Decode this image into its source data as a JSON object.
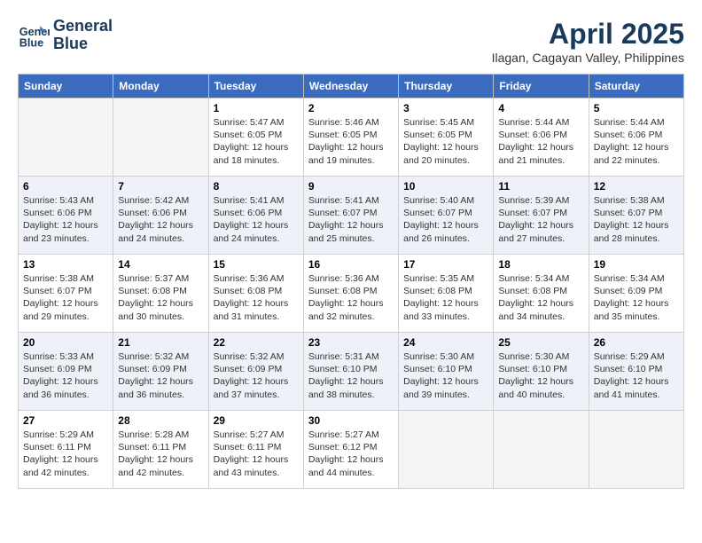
{
  "header": {
    "logo_line1": "General",
    "logo_line2": "Blue",
    "title": "April 2025",
    "subtitle": "Ilagan, Cagayan Valley, Philippines"
  },
  "calendar": {
    "weekdays": [
      "Sunday",
      "Monday",
      "Tuesday",
      "Wednesday",
      "Thursday",
      "Friday",
      "Saturday"
    ],
    "weeks": [
      {
        "stripe": false,
        "days": [
          {
            "num": "",
            "info": ""
          },
          {
            "num": "",
            "info": ""
          },
          {
            "num": "1",
            "info": "Sunrise: 5:47 AM\nSunset: 6:05 PM\nDaylight: 12 hours and 18 minutes."
          },
          {
            "num": "2",
            "info": "Sunrise: 5:46 AM\nSunset: 6:05 PM\nDaylight: 12 hours and 19 minutes."
          },
          {
            "num": "3",
            "info": "Sunrise: 5:45 AM\nSunset: 6:05 PM\nDaylight: 12 hours and 20 minutes."
          },
          {
            "num": "4",
            "info": "Sunrise: 5:44 AM\nSunset: 6:06 PM\nDaylight: 12 hours and 21 minutes."
          },
          {
            "num": "5",
            "info": "Sunrise: 5:44 AM\nSunset: 6:06 PM\nDaylight: 12 hours and 22 minutes."
          }
        ]
      },
      {
        "stripe": true,
        "days": [
          {
            "num": "6",
            "info": "Sunrise: 5:43 AM\nSunset: 6:06 PM\nDaylight: 12 hours and 23 minutes."
          },
          {
            "num": "7",
            "info": "Sunrise: 5:42 AM\nSunset: 6:06 PM\nDaylight: 12 hours and 24 minutes."
          },
          {
            "num": "8",
            "info": "Sunrise: 5:41 AM\nSunset: 6:06 PM\nDaylight: 12 hours and 24 minutes."
          },
          {
            "num": "9",
            "info": "Sunrise: 5:41 AM\nSunset: 6:07 PM\nDaylight: 12 hours and 25 minutes."
          },
          {
            "num": "10",
            "info": "Sunrise: 5:40 AM\nSunset: 6:07 PM\nDaylight: 12 hours and 26 minutes."
          },
          {
            "num": "11",
            "info": "Sunrise: 5:39 AM\nSunset: 6:07 PM\nDaylight: 12 hours and 27 minutes."
          },
          {
            "num": "12",
            "info": "Sunrise: 5:38 AM\nSunset: 6:07 PM\nDaylight: 12 hours and 28 minutes."
          }
        ]
      },
      {
        "stripe": false,
        "days": [
          {
            "num": "13",
            "info": "Sunrise: 5:38 AM\nSunset: 6:07 PM\nDaylight: 12 hours and 29 minutes."
          },
          {
            "num": "14",
            "info": "Sunrise: 5:37 AM\nSunset: 6:08 PM\nDaylight: 12 hours and 30 minutes."
          },
          {
            "num": "15",
            "info": "Sunrise: 5:36 AM\nSunset: 6:08 PM\nDaylight: 12 hours and 31 minutes."
          },
          {
            "num": "16",
            "info": "Sunrise: 5:36 AM\nSunset: 6:08 PM\nDaylight: 12 hours and 32 minutes."
          },
          {
            "num": "17",
            "info": "Sunrise: 5:35 AM\nSunset: 6:08 PM\nDaylight: 12 hours and 33 minutes."
          },
          {
            "num": "18",
            "info": "Sunrise: 5:34 AM\nSunset: 6:08 PM\nDaylight: 12 hours and 34 minutes."
          },
          {
            "num": "19",
            "info": "Sunrise: 5:34 AM\nSunset: 6:09 PM\nDaylight: 12 hours and 35 minutes."
          }
        ]
      },
      {
        "stripe": true,
        "days": [
          {
            "num": "20",
            "info": "Sunrise: 5:33 AM\nSunset: 6:09 PM\nDaylight: 12 hours and 36 minutes."
          },
          {
            "num": "21",
            "info": "Sunrise: 5:32 AM\nSunset: 6:09 PM\nDaylight: 12 hours and 36 minutes."
          },
          {
            "num": "22",
            "info": "Sunrise: 5:32 AM\nSunset: 6:09 PM\nDaylight: 12 hours and 37 minutes."
          },
          {
            "num": "23",
            "info": "Sunrise: 5:31 AM\nSunset: 6:10 PM\nDaylight: 12 hours and 38 minutes."
          },
          {
            "num": "24",
            "info": "Sunrise: 5:30 AM\nSunset: 6:10 PM\nDaylight: 12 hours and 39 minutes."
          },
          {
            "num": "25",
            "info": "Sunrise: 5:30 AM\nSunset: 6:10 PM\nDaylight: 12 hours and 40 minutes."
          },
          {
            "num": "26",
            "info": "Sunrise: 5:29 AM\nSunset: 6:10 PM\nDaylight: 12 hours and 41 minutes."
          }
        ]
      },
      {
        "stripe": false,
        "days": [
          {
            "num": "27",
            "info": "Sunrise: 5:29 AM\nSunset: 6:11 PM\nDaylight: 12 hours and 42 minutes."
          },
          {
            "num": "28",
            "info": "Sunrise: 5:28 AM\nSunset: 6:11 PM\nDaylight: 12 hours and 42 minutes."
          },
          {
            "num": "29",
            "info": "Sunrise: 5:27 AM\nSunset: 6:11 PM\nDaylight: 12 hours and 43 minutes."
          },
          {
            "num": "30",
            "info": "Sunrise: 5:27 AM\nSunset: 6:12 PM\nDaylight: 12 hours and 44 minutes."
          },
          {
            "num": "",
            "info": ""
          },
          {
            "num": "",
            "info": ""
          },
          {
            "num": "",
            "info": ""
          }
        ]
      }
    ]
  }
}
